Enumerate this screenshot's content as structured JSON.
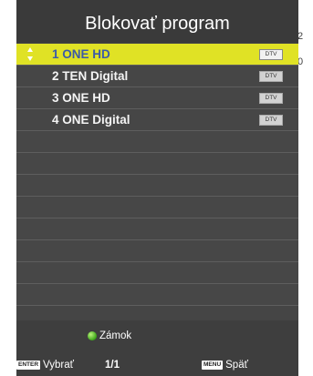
{
  "background": {
    "edge_char_1": "2",
    "edge_char_2": "0"
  },
  "dialog": {
    "title": "Blokovať program"
  },
  "channels": [
    {
      "label": "1 ONE HD",
      "badge": "DTV"
    },
    {
      "label": "2 TEN Digital",
      "badge": "DTV"
    },
    {
      "label": "3 ONE HD",
      "badge": "DTV"
    },
    {
      "label": "4 ONE Digital",
      "badge": "DTV"
    }
  ],
  "footer": {
    "legend_label": "Zámok",
    "enter_key": "ENTER",
    "enter_label": "Vybrať",
    "page_indicator": "1/1",
    "menu_key": "MENU",
    "menu_label": "Späť"
  },
  "colors": {
    "selected_row": "#e0e225",
    "lock_dot": "#3aa317"
  },
  "icons": [
    "up-down-arrows-icon",
    "green-dot-icon"
  ]
}
